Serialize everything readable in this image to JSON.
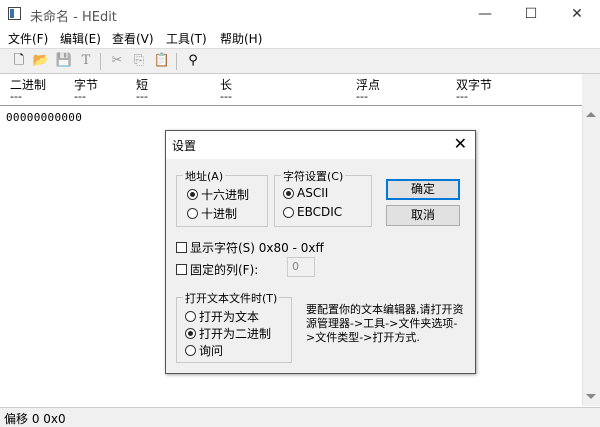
{
  "window": {
    "title": "未命名 - HEdit",
    "minimize_glyph": "—",
    "maximize_glyph": "☐",
    "close_glyph": "✕"
  },
  "menu": [
    {
      "label": "文件(F)"
    },
    {
      "label": "编辑(E)"
    },
    {
      "label": "查看(V)"
    },
    {
      "label": "工具(T)"
    },
    {
      "label": "帮助(H)"
    }
  ],
  "toolbar": {
    "buttons": [
      {
        "icon": "new-file-icon",
        "glyph": "🗋"
      },
      {
        "icon": "open-folder-icon",
        "glyph": "📂"
      },
      {
        "icon": "save-icon",
        "glyph": "💾"
      },
      {
        "icon": "font-icon",
        "glyph": "T"
      },
      {
        "icon": "cut-icon",
        "glyph": "✂"
      },
      {
        "icon": "copy-icon",
        "glyph": "⎘"
      },
      {
        "icon": "paste-icon",
        "glyph": "📋"
      },
      {
        "icon": "binoculars-icon",
        "glyph": "⚲"
      }
    ]
  },
  "header_fields": [
    {
      "label": "二进制",
      "value": "---"
    },
    {
      "label": "字节",
      "value": "---"
    },
    {
      "label": "短",
      "value": "---"
    },
    {
      "label": "长",
      "value": "---"
    },
    {
      "label": "浮点",
      "value": "---"
    },
    {
      "label": "双字节",
      "value": "---"
    }
  ],
  "editor": {
    "offset_line": "00000000000"
  },
  "status": {
    "text": "偏移 0 0x0"
  },
  "dialog": {
    "title": "设置",
    "close_glyph": "✕",
    "address_group": {
      "label": "地址(A)",
      "options": [
        {
          "label": "十六进制",
          "checked": true
        },
        {
          "label": "十进制",
          "checked": false
        }
      ]
    },
    "charset_group": {
      "label": "字符设置(C)",
      "options": [
        {
          "label": "ASCII",
          "checked": true
        },
        {
          "label": "EBCDIC",
          "checked": false
        }
      ]
    },
    "ok_label": "确定",
    "cancel_label": "取消",
    "show_chars_label": "显示字符(S) 0x80 - 0xff",
    "fixed_columns_label": "固定的列(F):",
    "fixed_columns_value": "0",
    "open_text_group": {
      "label": "打开文本文件时(T)",
      "options": [
        {
          "label": "打开为文本",
          "checked": false
        },
        {
          "label": "打开为二进制",
          "checked": true
        },
        {
          "label": "询问",
          "checked": false
        }
      ]
    },
    "hint": "要配置你的文本编辑器,请打开资源管理器->工具->文件夹选项->文件类型->打开方式."
  }
}
